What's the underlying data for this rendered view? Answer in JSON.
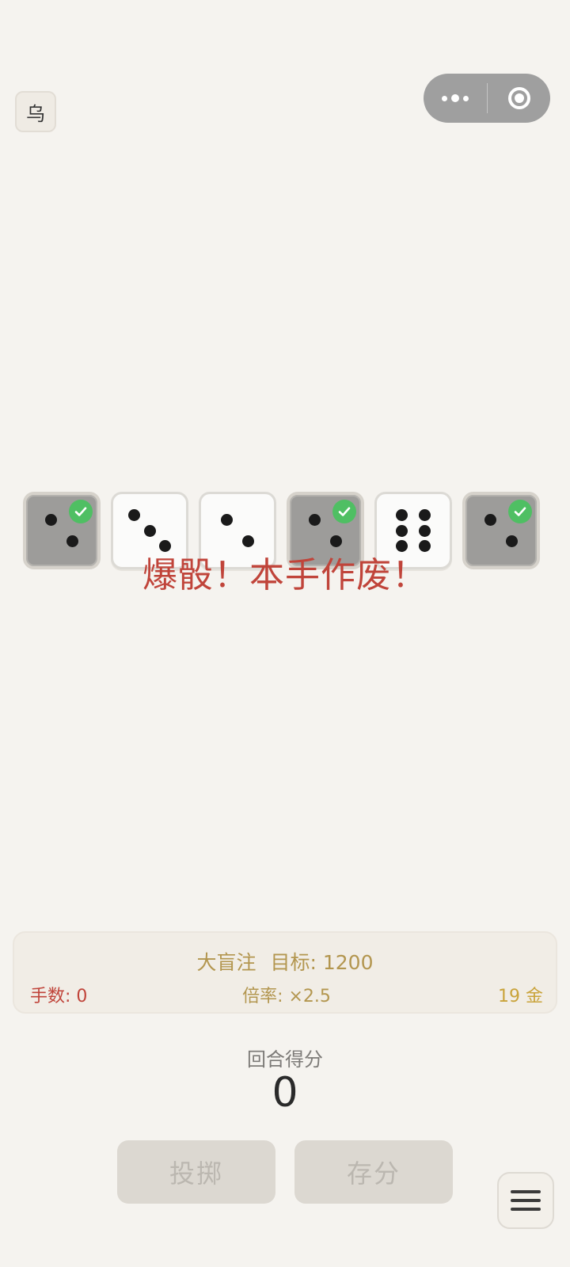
{
  "top_bar": {
    "corner_label": "乌",
    "capsule_more_icon": "more-dots-icon",
    "capsule_close_icon": "target-circle-icon"
  },
  "dice": [
    {
      "value": 2,
      "held": true
    },
    {
      "value": 3,
      "held": false
    },
    {
      "value": 2,
      "held": false
    },
    {
      "value": 2,
      "held": true
    },
    {
      "value": 6,
      "held": false
    },
    {
      "value": 2,
      "held": true
    }
  ],
  "message": "爆骰！本手作废！",
  "info": {
    "blind": "大盲注",
    "target_label": "目标: 1200",
    "hands": "手数: 0",
    "multiplier": "倍率: ×2.5",
    "gold": "19 金"
  },
  "round": {
    "label": "回合得分",
    "score": "0"
  },
  "actions": {
    "roll": "投掷",
    "bank": "存分"
  },
  "colors": {
    "background": "#f5f3ef",
    "bust_red": "#c0443a",
    "gold": "#b3964f",
    "held_check": "#4fbf63"
  }
}
